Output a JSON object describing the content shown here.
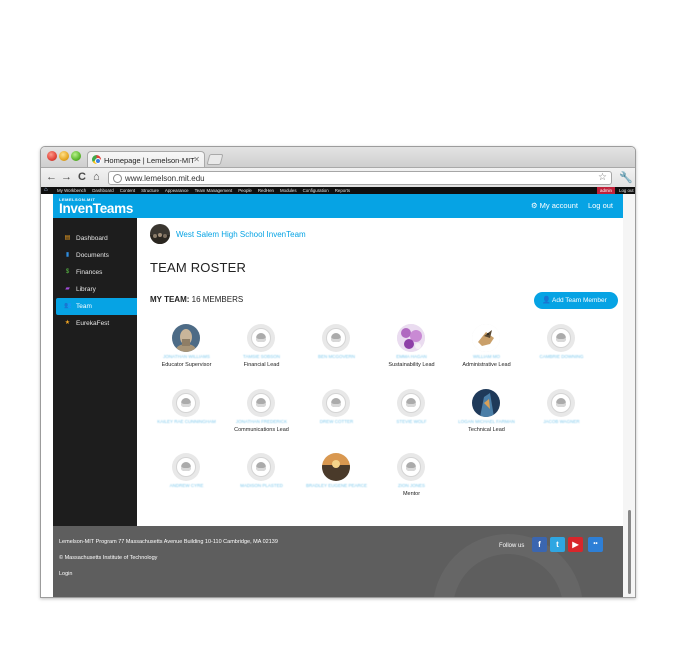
{
  "browser": {
    "tab_title": "Homepage | Lemelson-MIT",
    "tab_close": "✕",
    "url": "www.lemelson.mit.edu",
    "back": "←",
    "forward": "→",
    "reload": "C",
    "home": "⌂",
    "star": "☆",
    "wrench": "🔧"
  },
  "admin_toolbar": {
    "home_icon": "home-icon",
    "items": [
      "My Workbench",
      "Dashboard",
      "Content",
      "Structure",
      "Appearance",
      "Team Management",
      "People",
      "RedHen",
      "Modules",
      "Configuration",
      "Reports"
    ],
    "user": "admin",
    "logout": "Log out"
  },
  "header": {
    "logo_small": "LEMELSON-MIT",
    "logo_big": "InvenTeams",
    "my_account": "My account",
    "logout": "Log out",
    "accent": "#06a3e4"
  },
  "sidebar": {
    "items": [
      {
        "label": "Dashboard",
        "icon": "chart-icon",
        "glyph": "▤",
        "color": "#f0a022"
      },
      {
        "label": "Documents",
        "icon": "document-icon",
        "glyph": "▮",
        "color": "#2f8ddf"
      },
      {
        "label": "Finances",
        "icon": "dollar-icon",
        "glyph": "$",
        "color": "#5cc246"
      },
      {
        "label": "Library",
        "icon": "book-icon",
        "glyph": "▰",
        "color": "#a04cd8"
      },
      {
        "label": "Team",
        "icon": "people-icon",
        "glyph": "👥",
        "color": "#ffffff"
      },
      {
        "label": "EurekaFest",
        "icon": "trophy-icon",
        "glyph": "★",
        "color": "#f2a522"
      }
    ],
    "active": "Team"
  },
  "main": {
    "school_name": "West Salem High School InvenTeam",
    "title": "TEAM ROSTER",
    "my_team_label": "MY TEAM:",
    "my_team_count": "16 MEMBERS",
    "add_button": "Add Team Member"
  },
  "members": [
    {
      "name": "JONATHAN WILLIAMS",
      "role": "Educator Supervisor",
      "avatar": "photo-statue"
    },
    {
      "name": "TAMSIE SOBSON",
      "role": "Financial Lead",
      "avatar": "default"
    },
    {
      "name": "BEN MCGOVERN",
      "role": "",
      "avatar": "default"
    },
    {
      "name": "EMMA HAGAN",
      "role": "Sustainability Lead",
      "avatar": "photo-flowers"
    },
    {
      "name": "WILLIAM MO",
      "role": "Administrative Lead",
      "avatar": "photo-bird"
    },
    {
      "name": "CAMBRIE DOWNING",
      "role": "",
      "avatar": "default"
    },
    {
      "name": "KAILEY RAE CUNNINGHAM",
      "role": "",
      "avatar": "default"
    },
    {
      "name": "JONATHAN FREDERICK",
      "role": "Communications Lead",
      "avatar": "default"
    },
    {
      "name": "DREW COTTER",
      "role": "",
      "avatar": "default"
    },
    {
      "name": "STEVIE WOLF",
      "role": "",
      "avatar": "default"
    },
    {
      "name": "LOGAN MICHAEL FARMAN",
      "role": "Technical Lead",
      "avatar": "photo-rock"
    },
    {
      "name": "JACOB WAGNER",
      "role": "",
      "avatar": "default"
    },
    {
      "name": "ANDREW CYRE",
      "role": "",
      "avatar": "default"
    },
    {
      "name": "MADISON PLASTED",
      "role": "",
      "avatar": "default"
    },
    {
      "name": "BRADLEY EUGENE PEARCE",
      "role": "",
      "avatar": "photo-sunset"
    },
    {
      "name": "ZION JONES",
      "role": "Mentor",
      "avatar": "default"
    }
  ],
  "footer": {
    "address": "Lemelson-MIT Program 77 Massachusetts Avenue Building 10-110 Cambridge, MA 02139",
    "copyright": "© Massachusetts Institute of Technology",
    "login": "Login",
    "follow": "Follow us",
    "social": [
      {
        "name": "facebook-icon",
        "glyph": "f",
        "color": "#3b66b0"
      },
      {
        "name": "twitter-icon",
        "glyph": "t",
        "color": "#2fa6e2"
      },
      {
        "name": "youtube-icon",
        "glyph": "▶",
        "color": "#d8262b"
      },
      {
        "name": "flickr-icon",
        "glyph": "••",
        "color": "#2e7fd6"
      }
    ]
  }
}
